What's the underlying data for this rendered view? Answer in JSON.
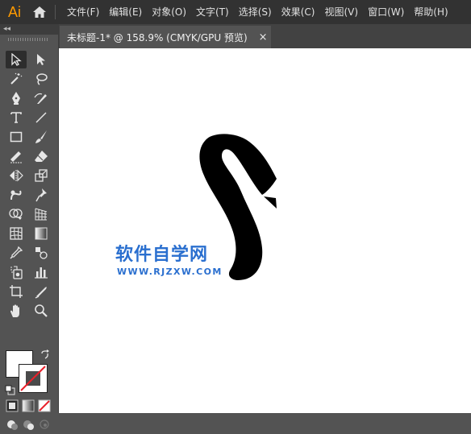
{
  "app": {
    "logo": "Ai"
  },
  "menu": {
    "items": [
      "文件(F)",
      "编辑(E)",
      "对象(O)",
      "文字(T)",
      "选择(S)",
      "效果(C)",
      "视图(V)",
      "窗口(W)",
      "帮助(H)"
    ]
  },
  "tab": {
    "label": "未标题-1* @ 158.9% (CMYK/GPU 预览)",
    "close": "×"
  },
  "toolbar": {
    "collapse": "◂◂",
    "tools": [
      "selection-tool",
      "direct-selection-tool",
      "magic-wand-tool",
      "lasso-tool",
      "pen-tool",
      "curvature-tool",
      "type-tool",
      "line-segment-tool",
      "rectangle-tool",
      "paintbrush-tool",
      "shaper-tool",
      "eraser-tool",
      "reflect-tool",
      "scale-tool",
      "warp-tool",
      "puppet-warp-tool",
      "shape-builder-tool",
      "perspective-grid-tool",
      "mesh-tool",
      "gradient-tool",
      "eyedropper-tool",
      "blend-tool",
      "symbol-sprayer-tool",
      "column-graph-tool",
      "artboard-tool",
      "slice-tool",
      "hand-tool",
      "zoom-tool"
    ]
  },
  "watermark": {
    "name": "软件自学网",
    "url": "WWW.RJZXW.COM"
  },
  "colors": {
    "accent": "#ff9a00",
    "watermark": "#2a6fcf",
    "canvas": "#ffffff",
    "chrome": "#323232"
  }
}
